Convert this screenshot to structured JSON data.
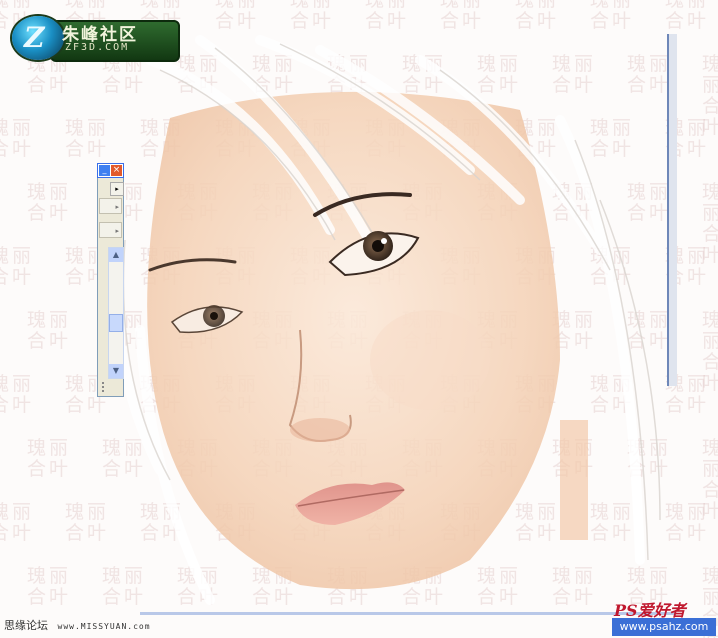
{
  "logo": {
    "name_cn": "朱峰社区",
    "domain": "ZF3D.COM",
    "badge_letter": "Z"
  },
  "watermark": {
    "line1": "瑰丽",
    "line2": "合叶"
  },
  "palette": {
    "minimize": "_",
    "close": "×",
    "menu_arrow": "▸",
    "scroll_up": "▲",
    "scroll_down": "▼"
  },
  "footer": {
    "forum_name": "思缘论坛",
    "forum_url": "www.MISSYUAN.com",
    "ps_logo": "PS爱好者",
    "ps_url": "www.psahz.com"
  },
  "colors": {
    "skin": "#f6d7bf",
    "hair": "#ffffff",
    "accent_red": "#c0182e",
    "title_blue": "#3a6ee8"
  }
}
